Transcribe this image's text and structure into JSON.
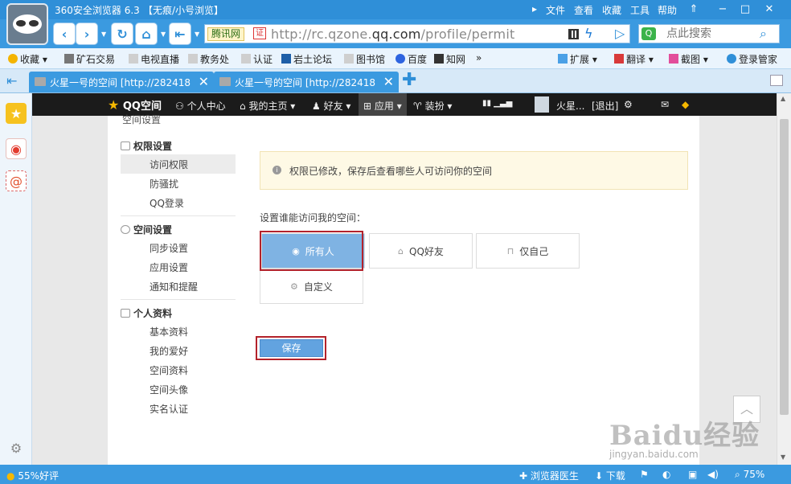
{
  "window": {
    "title": "360安全浏览器 6.3",
    "mode": "【无痕/小号浏览】",
    "menu": [
      "文件",
      "查看",
      "收藏",
      "工具",
      "帮助"
    ]
  },
  "address_bar": {
    "site_label": "腾讯网",
    "cert_label": "证",
    "url_prefix": "http://rc.qzone.",
    "url_domain": "qq.com",
    "url_suffix": "/profile/permit"
  },
  "search": {
    "placeholder": "点此搜索"
  },
  "bookmarks": {
    "favorites_label": "收藏",
    "items": [
      "矿石交易",
      "电视直播",
      "教务处",
      "认证",
      "岩土论坛",
      "图书馆",
      "百度",
      "知网"
    ],
    "more": "»",
    "right": [
      "扩展",
      "翻译",
      "截图",
      "登录管家"
    ]
  },
  "tabs": [
    {
      "label": "火星一号的空间 [http://282418"
    },
    {
      "label": "火星一号的空间 [http://282418"
    }
  ],
  "qzone_nav": {
    "logo": "QQ空间",
    "items": [
      "个人中心",
      "我的主页",
      "好友",
      "应用",
      "装扮"
    ],
    "user_name": "火星...",
    "logout": "[退出]"
  },
  "settings": {
    "clipped_title": "空间设置",
    "sections": [
      {
        "title": "权限设置",
        "links": [
          "访问权限",
          "防骚扰",
          "QQ登录"
        ],
        "active_index": 0
      },
      {
        "title": "空间设置",
        "links": [
          "同步设置",
          "应用设置",
          "通知和提醒"
        ]
      },
      {
        "title": "个人资料",
        "links": [
          "基本资料",
          "我的爱好",
          "空间资料",
          "空间头像",
          "实名认证"
        ]
      }
    ],
    "notice": "权限已修改，保存后查看哪些人可访问你的空间",
    "prompt": "设置谁能访问我的空间：",
    "options": [
      "所有人",
      "QQ好友",
      "仅自己",
      "自定义"
    ],
    "selected_option": "所有人",
    "save_label": "保存"
  },
  "watermark": {
    "brand": "Baidu经验",
    "sub": "jingyan.baidu.com"
  },
  "status_bar": {
    "rating": "55%好评",
    "doctor": "浏览器医生",
    "download": "下载",
    "zoom": "75%"
  },
  "colors": {
    "chrome_blue": "#3b9ae0",
    "selected_option": "#7fb3e3",
    "highlight_frame": "#b3222b",
    "save_button": "#62a3e0"
  }
}
